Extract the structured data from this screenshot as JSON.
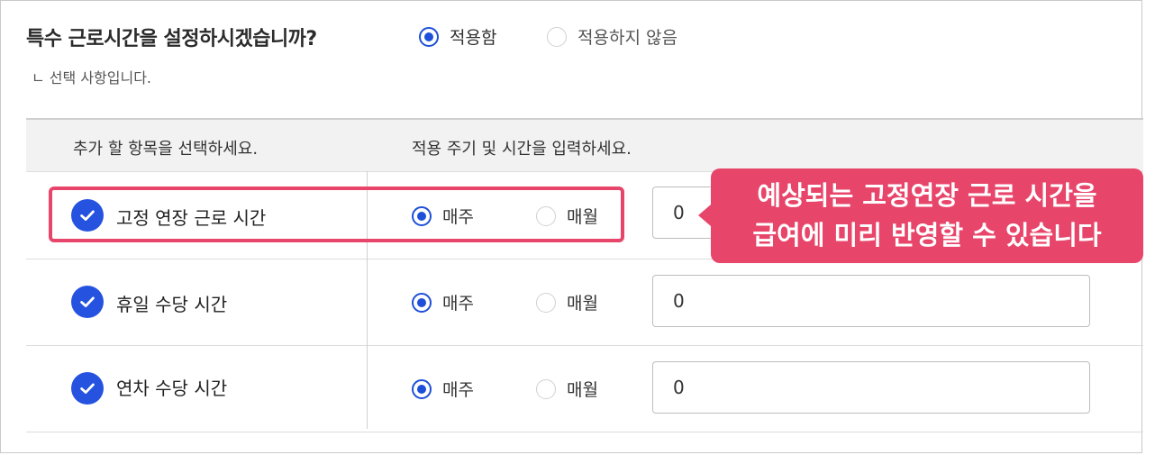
{
  "question": "특수 근로시간을 설정하시겠습니까?",
  "apply_options": [
    {
      "label": "적용함",
      "selected": true
    },
    {
      "label": "적용하지 않음",
      "selected": false
    }
  ],
  "hint": "ㄴ 선택 사항입니다.",
  "table": {
    "headers": [
      "추가 할 항목을 선택하세요.",
      "적용 주기 및 시간을 입력하세요."
    ],
    "rows": [
      {
        "label": "고정 연장 근로 시간",
        "checked": true,
        "cycle_options": [
          "매주",
          "매월"
        ],
        "selected_cycle": "매주",
        "hours": "0"
      },
      {
        "label": "휴일 수당 시간",
        "checked": true,
        "cycle_options": [
          "매주",
          "매월"
        ],
        "selected_cycle": "매주",
        "hours": "0"
      },
      {
        "label": "연차 수당 시간",
        "checked": true,
        "cycle_options": [
          "매주",
          "매월"
        ],
        "selected_cycle": "매주",
        "hours": "0"
      }
    ]
  },
  "callout": {
    "line1": "예상되는 고정연장 근로 시간을",
    "line2": "급여에 미리 반영할 수 있습니다"
  },
  "colors": {
    "accent": "#1e4fd8",
    "highlight": "#e8456a"
  }
}
